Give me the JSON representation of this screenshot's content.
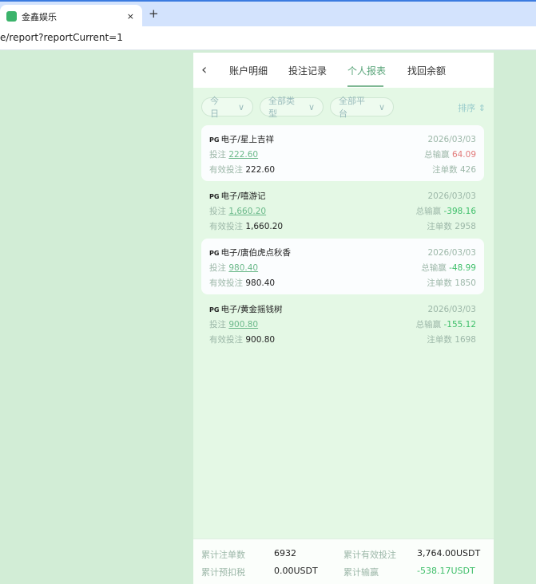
{
  "browser": {
    "tab_title": "金鑫娱乐",
    "close": "×",
    "new_tab": "+",
    "url": "e/report?reportCurrent=1"
  },
  "nav": {
    "back": "‹",
    "tabs": [
      "账户明细",
      "投注记录",
      "个人报表",
      "找回余额"
    ],
    "active": 2
  },
  "filters": {
    "date": "今日",
    "type": "全部类型",
    "platform": "全部平台",
    "sort": "排序 ⇕"
  },
  "labels": {
    "bet": "投注",
    "valid_bet": "有效投注",
    "total_win": "总输赢",
    "count": "注单数"
  },
  "records": [
    {
      "badge": "PG",
      "title": "电子/星上吉祥",
      "date": "2026/03/03",
      "bet": "222.60",
      "win": "64.09",
      "win_color": "red",
      "valid": "222.60",
      "count": "426"
    },
    {
      "badge": "PG",
      "title": "电子/嘻游记",
      "date": "2026/03/03",
      "bet": "1,660.20",
      "win": "-398.16",
      "win_color": "green",
      "valid": "1,660.20",
      "count": "2958"
    },
    {
      "badge": "PG",
      "title": "电子/唐伯虎点秋香",
      "date": "2026/03/03",
      "bet": "980.40",
      "win": "-48.99",
      "win_color": "green",
      "valid": "980.40",
      "count": "1850"
    },
    {
      "badge": "PG",
      "title": "电子/黄金摇钱树",
      "date": "2026/03/03",
      "bet": "900.80",
      "win": "-155.12",
      "win_color": "green",
      "valid": "900.80",
      "count": "1698"
    }
  ],
  "summary": {
    "total_count_label": "累计注单数",
    "total_count": "6932",
    "total_valid_label": "累计有效投注",
    "total_valid": "3,764.00USDT",
    "tax_label": "累计预扣税",
    "tax": "0.00USDT",
    "total_win_label": "累计输赢",
    "total_win": "-538.17USDT"
  }
}
